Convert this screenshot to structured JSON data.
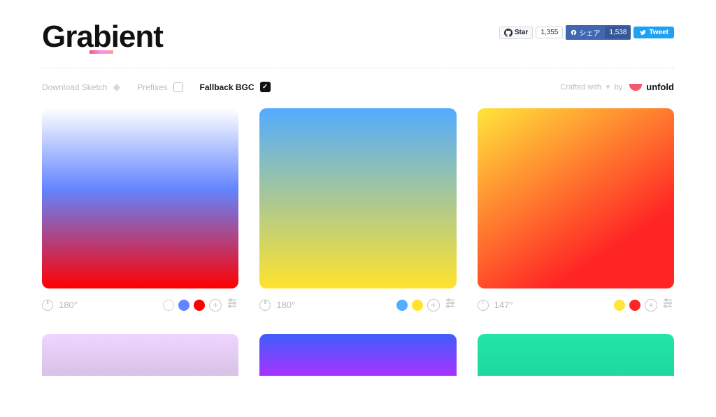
{
  "logo": "Grabient",
  "social": {
    "github_star_label": "Star",
    "github_star_count": "1,355",
    "facebook_share_label": "シェア",
    "facebook_share_count": "1,538",
    "twitter_label": "Tweet"
  },
  "toolbar": {
    "download_sketch": "Download Sketch",
    "prefixes": "Prefixes",
    "fallback_bgc": "Fallback BGC",
    "crafted_prefix": "Crafted with",
    "crafted_suffix": "by",
    "unfold": "unfold"
  },
  "gradients": [
    {
      "angle": "180°",
      "css": "linear-gradient(180deg, #ffffff 0%, #6284FF 45%, #FF0000 100%)",
      "stops": [
        {
          "color": "#ffffff",
          "outline": true
        },
        {
          "color": "#6284FF"
        },
        {
          "color": "#FF0000"
        }
      ]
    },
    {
      "angle": "180°",
      "css": "linear-gradient(180deg, #52ACFF 0%, #FFE32C 100%)",
      "stops": [
        {
          "color": "#52ACFF"
        },
        {
          "color": "#FFE32C"
        }
      ]
    },
    {
      "angle": "147°",
      "css": "linear-gradient(147deg, #FFE53B 0%, #FF2525 74%)",
      "stops": [
        {
          "color": "#FFE53B"
        },
        {
          "color": "#FF2525"
        }
      ]
    },
    {
      "css": "linear-gradient(180deg, #efd5ff 0%, #d8c2e5 100%)",
      "partial": true
    },
    {
      "css": "linear-gradient(180deg, #3f5efb 0%, #a832ff 100%)",
      "partial": true
    },
    {
      "css": "linear-gradient(180deg, #22e6a8 0%, #1fd89f 100%)",
      "partial": true
    }
  ]
}
